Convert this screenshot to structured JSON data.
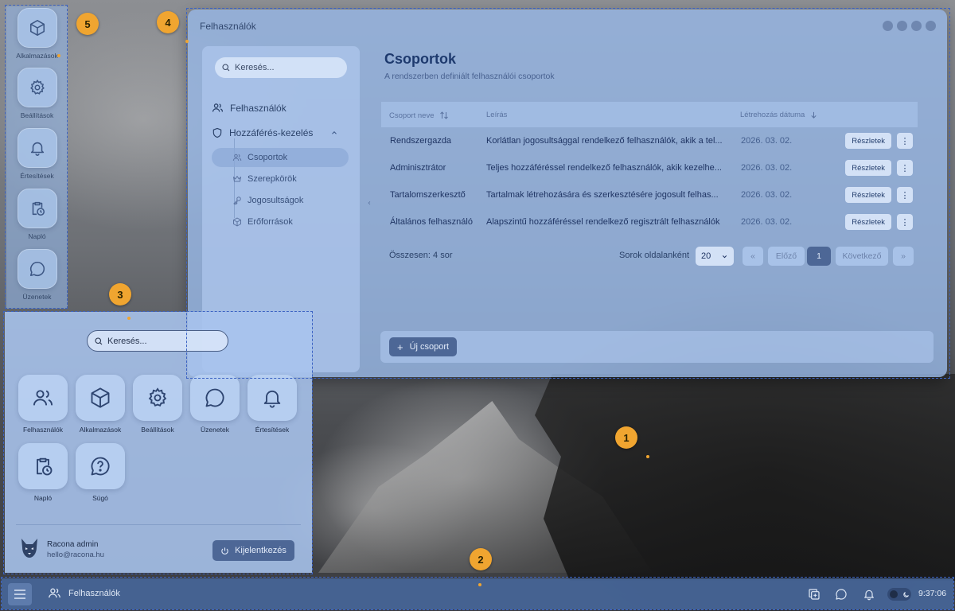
{
  "window": {
    "title": "Felhasználók",
    "search_placeholder": "Keresés...",
    "nav": {
      "users": "Felhasználók",
      "access": "Hozzáférés-kezelés",
      "sub": [
        "Csoportok",
        "Szerepkörök",
        "Jogosultságok",
        "Erőforrások"
      ]
    },
    "heading": "Csoportok",
    "subheading": "A rendszerben definiált felhasználói csoportok",
    "columns": [
      "Csoport neve",
      "Leírás",
      "Létrehozás dátuma"
    ],
    "rows": [
      {
        "name": "Rendszergazda",
        "desc": "Korlátlan jogosultsággal rendelkező felhasználók, akik a tel...",
        "date": "2026. 03. 02."
      },
      {
        "name": "Adminisztrátor",
        "desc": "Teljes hozzáféréssel rendelkező felhasználók, akik kezelhe...",
        "date": "2026. 03. 02."
      },
      {
        "name": "Tartalomszerkesztő",
        "desc": "Tartalmak létrehozására és szerkesztésére jogosult felhas...",
        "date": "2026. 03. 02."
      },
      {
        "name": "Általános felhasználó",
        "desc": "Alapszintű hozzáféréssel rendelkező regisztrált felhasználók",
        "date": "2026. 03. 02."
      }
    ],
    "details_label": "Részletek",
    "more_label": "⋮",
    "total": "Összesen: 4 sor",
    "rows_per_page_label": "Sorok oldalanként",
    "rows_per_page": "20",
    "first": "«",
    "prev": "Előző",
    "page": "1",
    "next": "Következő",
    "last": "»",
    "new_group": "Új csoport"
  },
  "dock": {
    "items": [
      {
        "label": "Alkalmazások",
        "icon": "box-icon"
      },
      {
        "label": "Beállítások",
        "icon": "gear-icon"
      },
      {
        "label": "Értesítések",
        "icon": "bell-icon"
      },
      {
        "label": "Napló",
        "icon": "clipboard-clock-icon"
      },
      {
        "label": "Üzenetek",
        "icon": "chat-icon"
      }
    ]
  },
  "start_menu": {
    "search_placeholder": "Keresés...",
    "apps": [
      {
        "label": "Felhasználók",
        "icon": "users-icon"
      },
      {
        "label": "Alkalmazások",
        "icon": "box-icon"
      },
      {
        "label": "Beállítások",
        "icon": "gear-icon"
      },
      {
        "label": "Üzenetek",
        "icon": "chat-icon"
      },
      {
        "label": "Értesítések",
        "icon": "bell-icon"
      },
      {
        "label": "Napló",
        "icon": "clipboard-clock-icon"
      },
      {
        "label": "Súgó",
        "icon": "help-icon"
      }
    ],
    "user_name": "Racona admin",
    "user_email": "hello@racona.hu",
    "logout": "Kijelentkezés"
  },
  "taskbar": {
    "active_app": "Felhasználók",
    "clock": "9:37:06"
  },
  "markers": [
    "1",
    "2",
    "3",
    "4",
    "5"
  ],
  "colors": {
    "accent": "#4d6796",
    "marker": "#f0a530",
    "annotation_border": "#3b63c4",
    "taskbar": "#46649a"
  }
}
